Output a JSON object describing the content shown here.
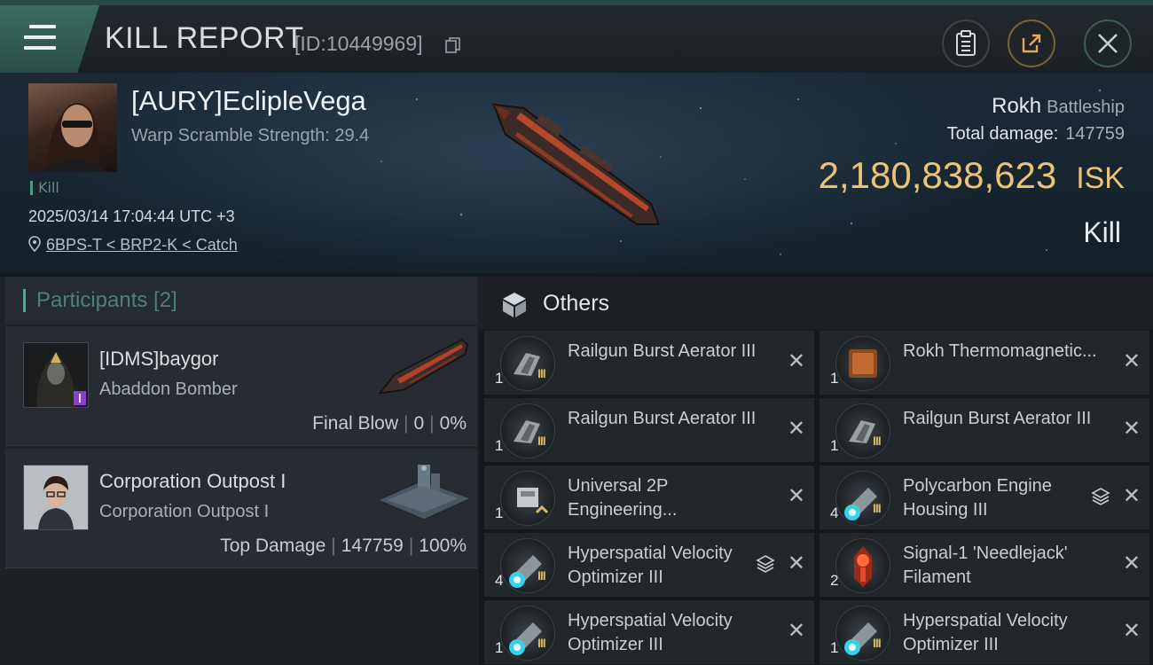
{
  "header": {
    "title": "KILL REPORT",
    "report_id": "[ID:10449969]",
    "victim": {
      "name": "[AURY]EclipleVega",
      "scramble": "Warp Scramble Strength: 29.4",
      "tag": "Kill",
      "datetime": "2025/03/14 17:04:44 UTC +3",
      "location": "6BPS-T < BRP2-K < Catch"
    },
    "ship": {
      "name": "Rokh",
      "class": "Battleship",
      "total_damage_label": "Total damage:",
      "total_damage": "147759",
      "isk_value": "2,180,838,623",
      "isk_unit": "ISK",
      "result": "Kill"
    }
  },
  "participants": {
    "heading": "Participants [2]",
    "rows": [
      {
        "name": "[IDMS]baygor",
        "ship": "Abaddon Bomber",
        "role": "Final Blow",
        "damage": "0",
        "percent": "0%"
      },
      {
        "name": "Corporation Outpost I",
        "ship": "Corporation Outpost I",
        "role": "Top Damage",
        "damage": "147759",
        "percent": "100%"
      }
    ]
  },
  "others": {
    "heading": "Others",
    "items": [
      {
        "name": "Railgun Burst Aerator III",
        "qty": "1",
        "tier": "III",
        "icon": "railgun-aerator-icon"
      },
      {
        "name": "Rokh Thermomagnetic...",
        "qty": "1",
        "tier": "",
        "icon": "blueprint-icon"
      },
      {
        "name": "Railgun Burst Aerator III",
        "qty": "1",
        "tier": "III",
        "icon": "railgun-aerator-icon"
      },
      {
        "name": "Railgun Burst Aerator III",
        "qty": "1",
        "tier": "III",
        "icon": "railgun-aerator-icon"
      },
      {
        "name": "Universal 2P Engineering...",
        "qty": "1",
        "tier": "^",
        "icon": "engineering-module-icon"
      },
      {
        "name": "Polycarbon Engine Housing III",
        "qty": "4",
        "tier": "III",
        "icon": "engine-housing-icon"
      },
      {
        "name": "Hyperspatial Velocity Optimizer III",
        "qty": "4",
        "tier": "III",
        "icon": "velocity-optimizer-icon"
      },
      {
        "name": "Signal-1 'Needlejack' Filament",
        "qty": "2",
        "tier": "",
        "icon": "filament-icon"
      },
      {
        "name": "Hyperspatial Velocity Optimizer III",
        "qty": "1",
        "tier": "III",
        "icon": "velocity-optimizer-icon"
      },
      {
        "name": "Hyperspatial Velocity Optimizer III",
        "qty": "1",
        "tier": "III",
        "icon": "velocity-optimizer-icon"
      }
    ]
  },
  "colors": {
    "accent_teal": "#5aa394",
    "isk_gold": "#e9c476",
    "tier_gold": "#d8b860"
  }
}
